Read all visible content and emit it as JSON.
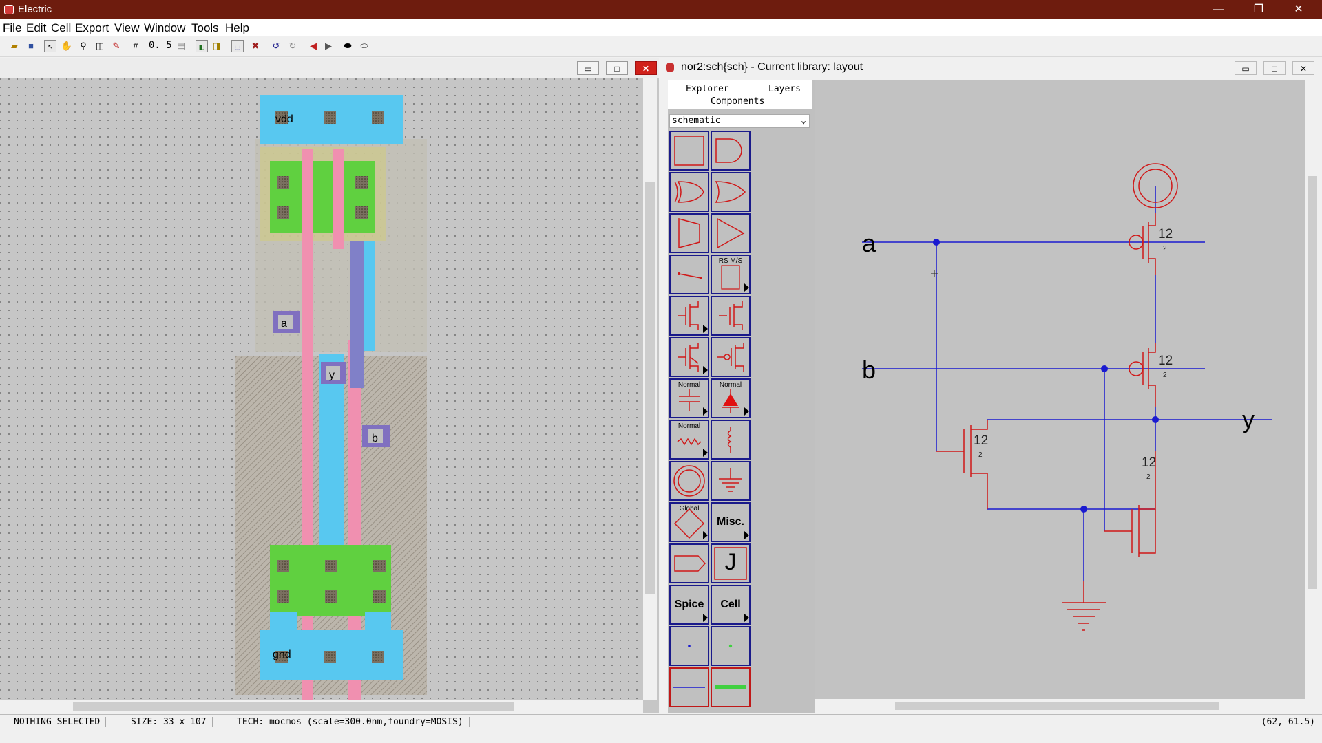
{
  "app": {
    "title": "Electric"
  },
  "menu": [
    "File",
    "Edit",
    "Cell",
    "Export",
    "View",
    "Window",
    "Tools",
    "Help"
  ],
  "toolbar": {
    "scale": "0. 5"
  },
  "layout_window": {
    "labels": {
      "vdd": "vdd",
      "a": "a",
      "y": "y",
      "b": "b",
      "gnd": "gnd"
    }
  },
  "schematic_window": {
    "title": "nor2:sch{sch} - Current library: layout",
    "tabs": {
      "explorer": "Explorer",
      "layers": "Layers",
      "components": "Components"
    },
    "technology_select": "schematic",
    "palette_labels": {
      "rsms": "RS M/S",
      "normal_cap": "Normal",
      "normal_diode": "Normal",
      "normal_res": "Normal",
      "global": "Global",
      "misc": "Misc.",
      "j": "J",
      "spice": "Spice",
      "cell": "Cell"
    },
    "net_labels": {
      "a": "a",
      "b": "b",
      "y": "y"
    },
    "transistor_labels": {
      "size": "12",
      "len": "2"
    }
  },
  "status": {
    "selection": "NOTHING SELECTED",
    "size": "SIZE: 33 x 107",
    "tech": "TECH: mocmos (scale=300.0nm,foundry=MOSIS)",
    "coords": "(62, 61.5)"
  },
  "colors": {
    "titlebar": "#6e1c0e",
    "schematic_wire": "#1a1ad0",
    "schematic_component": "#d01818",
    "metal1": "#58c8f0",
    "poly": "#f090b0",
    "active": "#60d040",
    "metal2": "#8080c8"
  }
}
